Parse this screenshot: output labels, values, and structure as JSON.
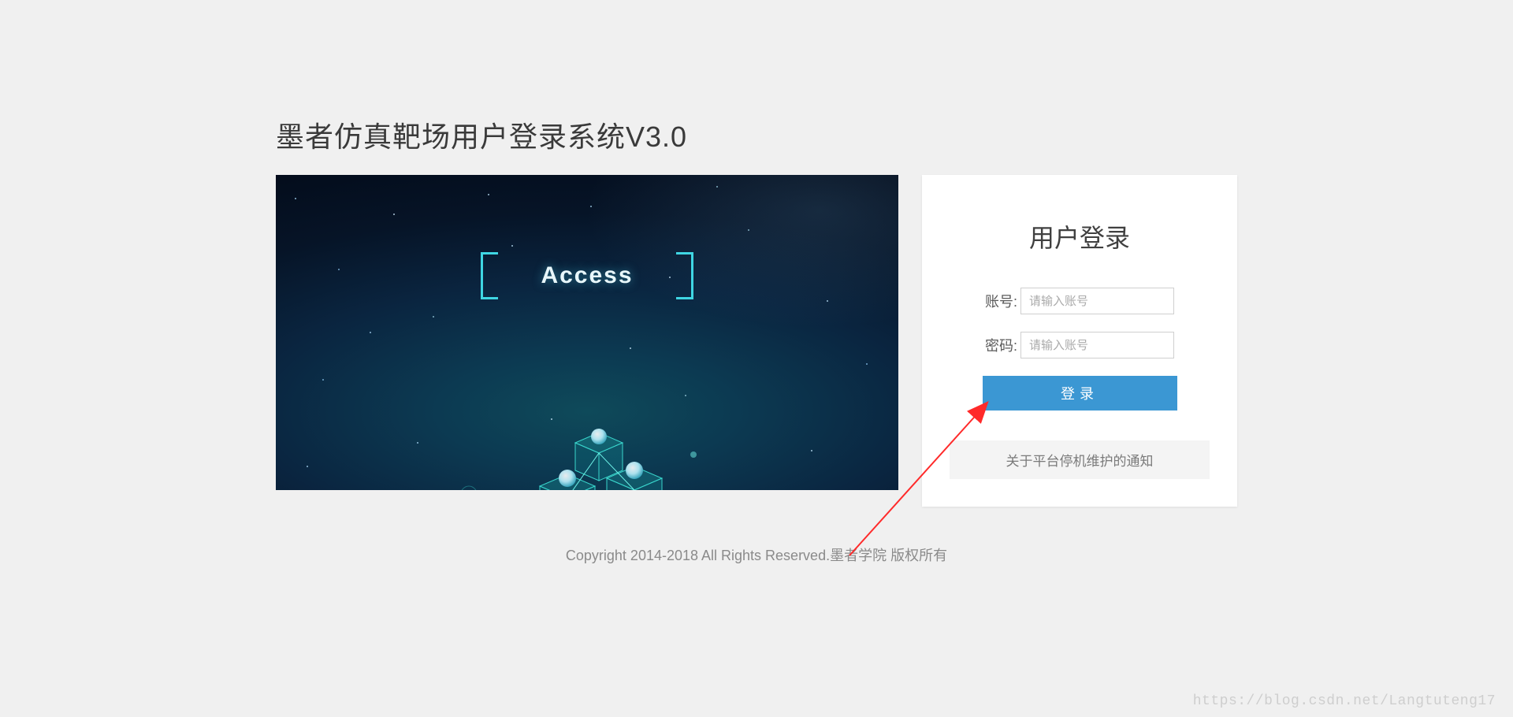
{
  "page": {
    "title": "墨者仿真靶场用户登录系统V3.0"
  },
  "hero": {
    "caption": "Access"
  },
  "login": {
    "heading": "用户登录",
    "username_label": "账号:",
    "username_placeholder": "请输入账号",
    "password_label": "密码:",
    "password_placeholder": "请输入账号",
    "submit_label": "登录",
    "notice_label": "关于平台停机维护的通知"
  },
  "footer": {
    "copyright": "Copyright 2014-2018 All Rights Reserved.墨者学院 版权所有"
  },
  "watermark": {
    "text": "https://blog.csdn.net/Langtuteng17"
  },
  "colors": {
    "primary_button": "#3b97d3",
    "accent_cyan": "#3fd6e3",
    "arrow": "#ff2a2a"
  }
}
